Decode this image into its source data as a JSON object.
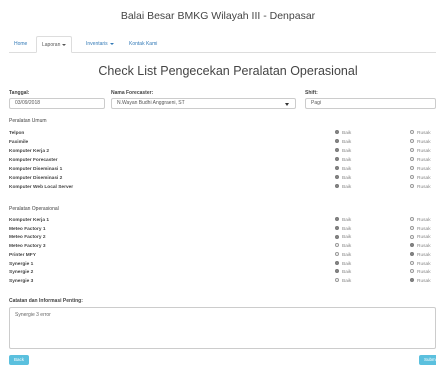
{
  "site_title": "Balai Besar BMKG Wilayah III - Denpasar",
  "nav": {
    "home": "Home",
    "laporan": "Laporan",
    "inventaris": "Inventaris",
    "kontak": "Kontak Kami"
  },
  "page_title": "Check List Pengecekan Peralatan Operasional",
  "form": {
    "tanggal_label": "Tanggal:",
    "tanggal_value": "03/09/2018",
    "forecaster_label": "Nama Forecaster:",
    "forecaster_value": "N.Wayan Budhi Anggraeni, ST",
    "shift_label": "Shift:",
    "shift_value": "Pagi"
  },
  "option_labels": {
    "baik": "Baik",
    "rusak": "Rusak"
  },
  "peralatan_umum": {
    "title": "Peralatan Umum",
    "items": [
      {
        "label": "Telpon",
        "status": "Baik"
      },
      {
        "label": "Faximile",
        "status": "Baik"
      },
      {
        "label": "Komputer Kerja 2",
        "status": "Baik"
      },
      {
        "label": "Komputer Forecaster",
        "status": "Baik"
      },
      {
        "label": "Komputer Diseminasi 1",
        "status": "Baik"
      },
      {
        "label": "Komputer Diseminasi 2",
        "status": "Baik"
      },
      {
        "label": "Komputer Web Local Server",
        "status": "Baik"
      }
    ]
  },
  "peralatan_operasional": {
    "title": "Peralatan Operasional",
    "items": [
      {
        "label": "Komputer Kerja 1",
        "status": "Baik"
      },
      {
        "label": "Meteo Factory 1",
        "status": "Baik"
      },
      {
        "label": "Meteo Factory 2",
        "status": "Baik"
      },
      {
        "label": "Meteo Factory 3",
        "status": "Rusak"
      },
      {
        "label": "Printer MFY",
        "status": "Rusak"
      },
      {
        "label": "Synergie 1",
        "status": "Baik"
      },
      {
        "label": "Synergie 2",
        "status": "Baik"
      },
      {
        "label": "Synergie 3",
        "status": "Rusak"
      }
    ]
  },
  "notes": {
    "label": "Catatan dan Informasi Penting:",
    "value": "Synergie 3 error"
  },
  "buttons": {
    "back": "Back",
    "submit": "Submit"
  }
}
